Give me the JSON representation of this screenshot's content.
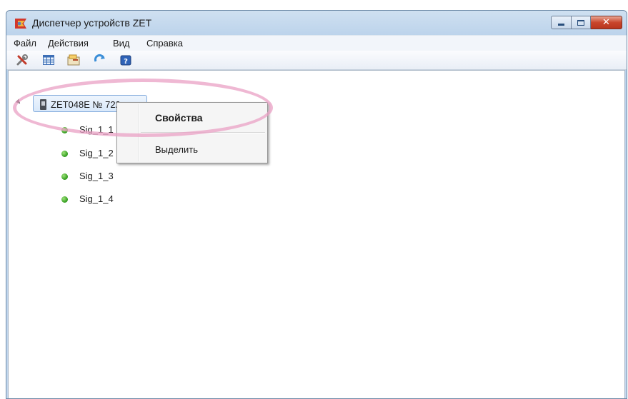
{
  "window": {
    "title": "Диспетчер устройств ZET",
    "icon": "zet-app-icon",
    "caption_buttons": {
      "minimize": "minimize-icon",
      "maximize": "maximize-icon",
      "close": "x"
    }
  },
  "menubar": {
    "items": [
      {
        "label": "Файл"
      },
      {
        "label": "Действия"
      },
      {
        "label": "Вид"
      },
      {
        "label": "Справка"
      }
    ]
  },
  "toolbar": {
    "buttons": [
      {
        "icon": "tools-icon"
      },
      {
        "icon": "table-icon"
      },
      {
        "icon": "properties-icon"
      },
      {
        "icon": "refresh-icon"
      },
      {
        "icon": "help-icon"
      }
    ]
  },
  "tree": {
    "device": {
      "label": "ZET048E № 722"
    },
    "signals": [
      {
        "label": "Sig_1_1",
        "status_color": "#3aa92a"
      },
      {
        "label": "Sig_1_2",
        "status_color": "#3aa92a"
      },
      {
        "label": "Sig_1_3",
        "status_color": "#3aa92a"
      },
      {
        "label": "Sig_1_4",
        "status_color": "#3aa92a"
      }
    ]
  },
  "context_menu": {
    "items": [
      {
        "label": "Свойства",
        "default": true
      },
      {
        "label": "Выделить"
      }
    ]
  },
  "annotation": {
    "color": "#e9a0c4"
  }
}
